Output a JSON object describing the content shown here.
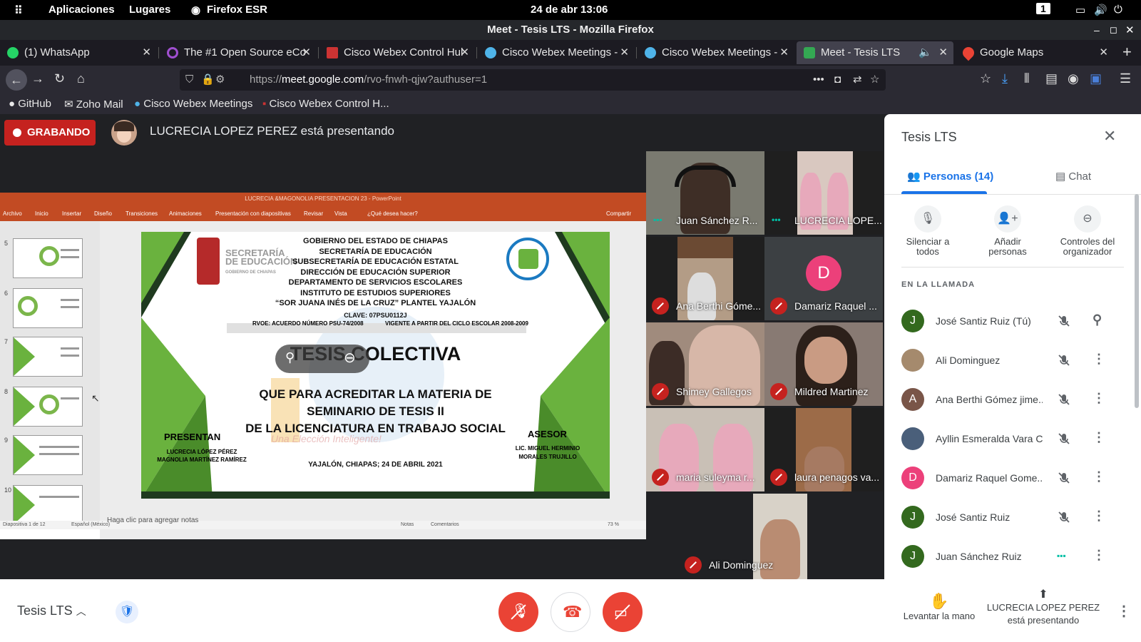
{
  "system": {
    "apps": "Aplicaciones",
    "places": "Lugares",
    "firefox": "Firefox ESR",
    "clock": "24 de abr  13:06",
    "workspace": "1"
  },
  "browser": {
    "window_title": "Meet - Tesis LTS - Mozilla Firefox",
    "tabs": [
      {
        "label": "(1) WhatsApp",
        "color": "#25d366"
      },
      {
        "label": "The #1 Open Source eCo",
        "color": "#a04fd0"
      },
      {
        "label": "Cisco Webex Control Hul",
        "color": "#cc3333"
      },
      {
        "label": "Cisco Webex Meetings -",
        "color": "#4fb3e8"
      },
      {
        "label": "Cisco Webex Meetings -",
        "color": "#4fb3e8"
      },
      {
        "label": "Meet - Tesis LTS",
        "color": "#34a853"
      },
      {
        "label": "Google Maps",
        "color": "#ea4335"
      }
    ],
    "url_prefix": "https://",
    "url_domain": "meet.google.com",
    "url_path": "/rvo-fnwh-qjw?authuser=1",
    "bookmarks": [
      "GitHub",
      "Zoho Mail",
      "Cisco Webex Meetings",
      "Cisco Webex Control H..."
    ]
  },
  "meet": {
    "recording": "GRABANDO",
    "presenting": "LUCRECIA LOPEZ PEREZ está presentando",
    "meeting_name": "Tesis LTS",
    "raise_hand": "Levantar la mano",
    "present_line1": "LUCRECIA LOPEZ PEREZ",
    "present_line2": "está presentando",
    "tiles": [
      "Juan Sánchez R...",
      "LUCRECIA LOPE...",
      "Ana Berthi Góme...",
      "Damariz Raquel ...",
      "Shimey Gallegos",
      "Mildred Martinez",
      "maria suleyma r...",
      "laura penagos va...",
      "Ali Dominguez"
    ],
    "tile_initial": "D"
  },
  "panel": {
    "title": "Tesis LTS",
    "tab_people": "Personas (14)",
    "tab_chat": "Chat",
    "btn_mute_1": "Silenciar a",
    "btn_mute_2": "todos",
    "btn_add_1": "Añadir",
    "btn_add_2": "personas",
    "btn_host_1": "Controles del",
    "btn_host_2": "organizador",
    "section": "EN LA LLAMADA",
    "people": [
      {
        "name": "José Santiz Ruiz (Tú)",
        "initial": "J",
        "color": "#33691e"
      },
      {
        "name": "Ali Dominguez",
        "initial": "",
        "color": "#a58a6d"
      },
      {
        "name": "Ana Berthi Gómez jime...",
        "initial": "A",
        "color": "#795548"
      },
      {
        "name": "Ayllin Esmeralda Vara C...",
        "initial": "",
        "color": "#4a5f7a"
      },
      {
        "name": "Damariz Raquel Gome...",
        "initial": "D",
        "color": "#ec407a"
      },
      {
        "name": "José Santiz Ruiz",
        "initial": "J",
        "color": "#33691e"
      },
      {
        "name": "Juan Sánchez Ruiz",
        "initial": "J",
        "color": "#33691e"
      }
    ]
  },
  "ppt": {
    "window_title": "LUCRECIA &MAGONOLIA PRESENTACION 23 - PowerPoint",
    "ribbon": [
      "Archivo",
      "Inicio",
      "Insertar",
      "Diseño",
      "Transiciones",
      "Animaciones",
      "Presentación con diapositivas",
      "Revisar",
      "Vista",
      "¿Qué desea hacer?",
      "Compartir"
    ],
    "thumb_numbers": [
      "5",
      "6",
      "7",
      "8",
      "9",
      "10"
    ],
    "notes_placeholder": "Haga clic para agregar notas",
    "status_left": "Diapositiva 1 de 12",
    "status_lang": "Español (México)",
    "status_notes": "Notas",
    "status_comments": "Comentarios",
    "zoom": "73 %"
  },
  "slide": {
    "header": [
      "GOBIERNO DEL ESTADO DE CHIAPAS",
      "SECRETARÍA DE EDUCACIÓN",
      "SUBSECRETARÍA DE EDUCACIÓN ESTATAL",
      "DIRECCIÓN DE EDUCACIÓN SUPERIOR",
      "DEPARTAMENTO DE SERVICIOS ESCOLARES",
      "INSTITUTO DE ESTUDIOS SUPERIORES",
      "“SOR JUANA INÉS DE LA CRUZ” PLANTEL YAJALÓN"
    ],
    "clave": "CLAVE: 07PSU0112J",
    "rvoe": "RVOE: ACUERDO NÚMERO PSU-74/2008",
    "vigente": "VIGENTE A PARTIR DEL CICLO ESCOLAR 2008-2009",
    "title": "TESIS COLECTIVA",
    "sub1": "QUE PARA ACREDITAR LA MATERIA DE",
    "sub2": "SEMINARIO DE TESIS II",
    "sub3": "DE LA LICENCIATURA EN TRABAJO SOCIAL",
    "presentan": "PRESENTAN",
    "autor1": "LUCRECIA LÓPEZ PÉREZ",
    "autor2": "MAGNOLIA MARTÍNEZ RAMÍREZ",
    "asesor": "ASESOR",
    "asesor1": "LIC. MIGUEL HERMINIO",
    "asesor2": "MORALES TRUJILLO",
    "fecha": "YAJALÓN, CHIAPAS; 24 DE ABRIL 2021",
    "logo_text_1": "SECRETARÍA",
    "logo_text_2": "DE EDUCACIÓN",
    "logo_text_3": "GOBIERNO DE CHIAPAS",
    "watermark": "Una Elección Inteligente!"
  }
}
